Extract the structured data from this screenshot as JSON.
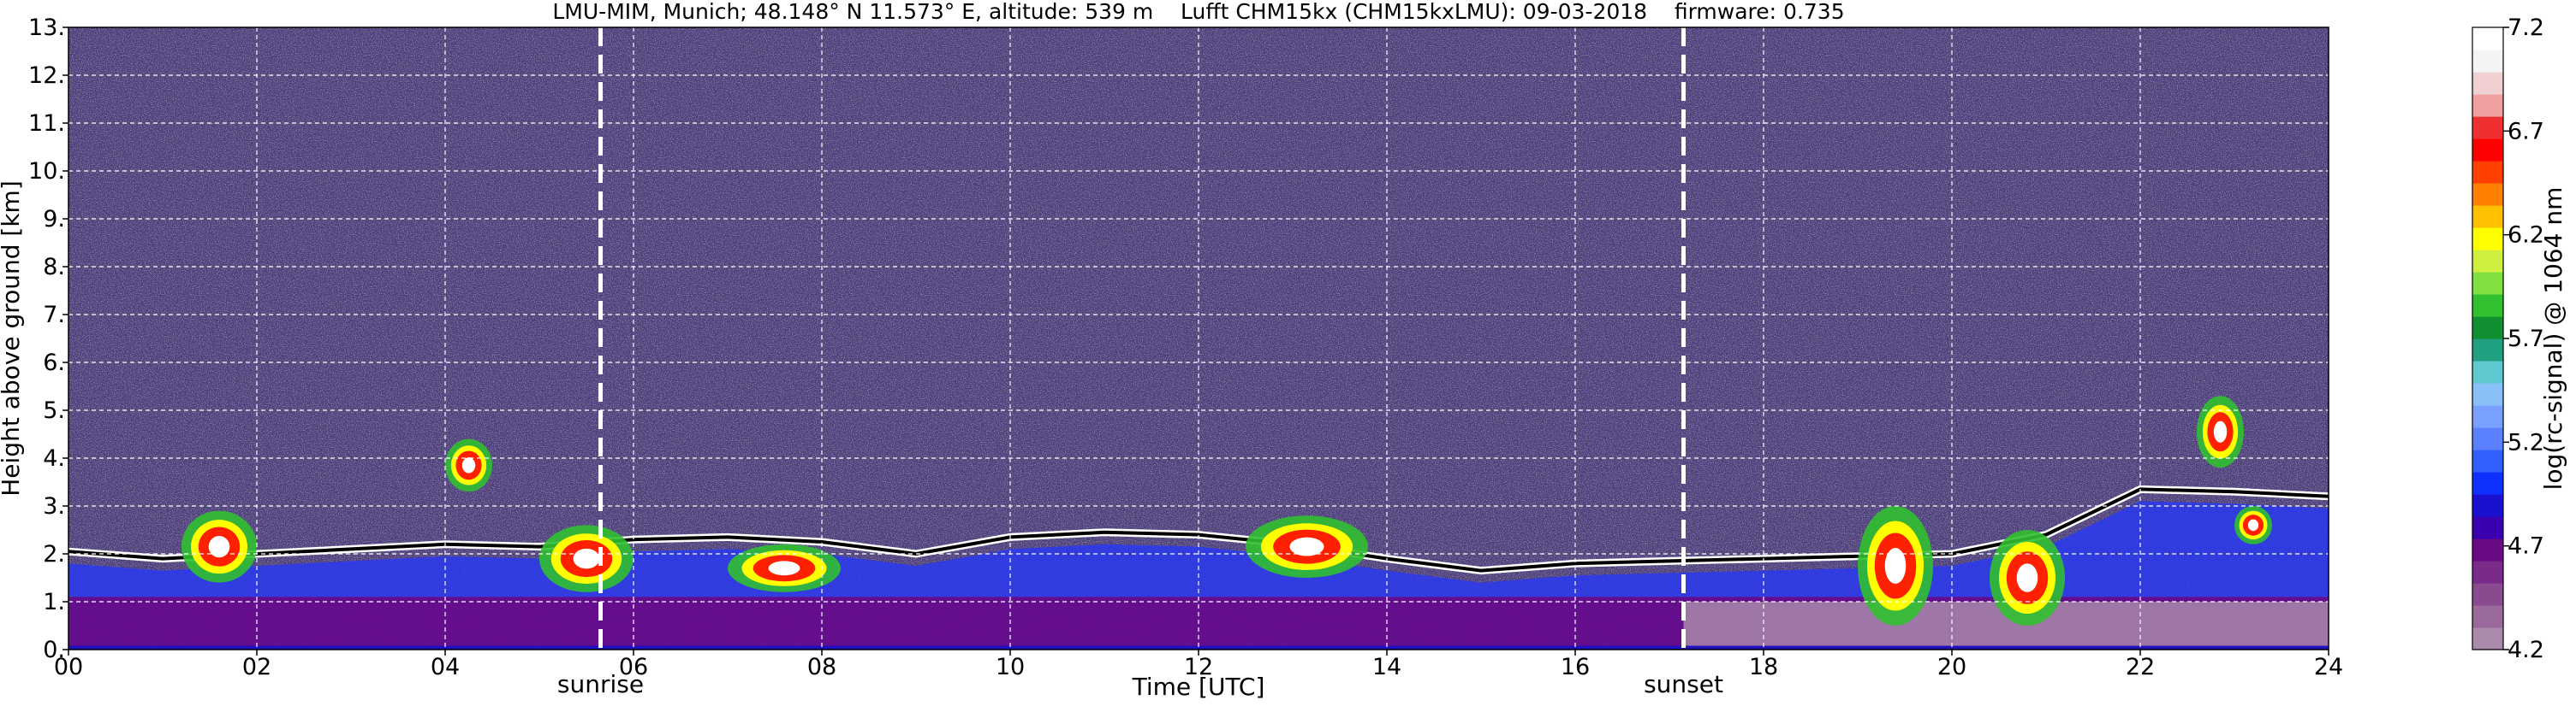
{
  "chart_data": {
    "type": "heatmap",
    "title": "LMU-MIM, Munich; 48.148° N 11.573° E, altitude: 539 m    Lufft CHM15kx (CHM15kxLMU): 09-03-2018    firmware: 0.735",
    "xlabel": "Time [UTC]",
    "ylabel": "Height above ground [km]",
    "xlim": [
      0,
      24
    ],
    "ylim": [
      0,
      13
    ],
    "x_ticks": [
      "00",
      "02",
      "04",
      "06",
      "08",
      "10",
      "12",
      "14",
      "16",
      "18",
      "20",
      "22",
      "24"
    ],
    "x_tick_values": [
      0,
      2,
      4,
      6,
      8,
      10,
      12,
      14,
      16,
      18,
      20,
      22,
      24
    ],
    "y_ticks": [
      "0.",
      "1.",
      "2.",
      "3.",
      "4.",
      "5.",
      "6.",
      "7.",
      "8.",
      "9.",
      "10.",
      "11.",
      "12.",
      "13."
    ],
    "y_tick_values": [
      0,
      1,
      2,
      3,
      4,
      5,
      6,
      7,
      8,
      9,
      10,
      11,
      12,
      13
    ],
    "grid": true,
    "events": [
      {
        "label": "sunrise",
        "time": 5.65
      },
      {
        "label": "sunset",
        "time": 17.15
      }
    ],
    "colorbar": {
      "label": "log(rc-signal) @ 1064 nm",
      "range": [
        4.2,
        7.2
      ],
      "ticks": [
        "4.2",
        "4.7",
        "5.2",
        "5.7",
        "6.2",
        "6.7",
        "7.2"
      ],
      "tick_values": [
        4.2,
        4.7,
        5.2,
        5.7,
        6.2,
        6.7,
        7.2
      ],
      "colors": [
        "#a98aab",
        "#9a6a9d",
        "#8a4a90",
        "#7a2a88",
        "#6a0a85",
        "#3a00b0",
        "#1a10d0",
        "#1030ff",
        "#3060ff",
        "#5a80ff",
        "#7aa0ff",
        "#8ac0f8",
        "#60c8d0",
        "#20a080",
        "#109030",
        "#30c030",
        "#80e040",
        "#d0f040",
        "#ffff00",
        "#ffc000",
        "#ff8000",
        "#ff4000",
        "#ff0000",
        "#ee3030",
        "#f0a0a0",
        "#f0d0d0",
        "#f4f4f4",
        "#ffffff"
      ]
    },
    "background_color": "#4a3d78",
    "boundary_layer_top_km": [
      [
        0,
        2.05
      ],
      [
        1,
        1.9
      ],
      [
        2,
        2.0
      ],
      [
        3,
        2.1
      ],
      [
        4,
        2.2
      ],
      [
        5,
        2.15
      ],
      [
        6,
        2.3
      ],
      [
        7,
        2.35
      ],
      [
        8,
        2.25
      ],
      [
        9,
        2.0
      ],
      [
        10,
        2.35
      ],
      [
        11,
        2.45
      ],
      [
        12,
        2.4
      ],
      [
        13,
        2.2
      ],
      [
        14,
        1.9
      ],
      [
        15,
        1.65
      ],
      [
        16,
        1.8
      ],
      [
        17,
        1.85
      ],
      [
        18,
        1.9
      ],
      [
        19,
        1.95
      ],
      [
        20,
        2.0
      ],
      [
        21,
        2.4
      ],
      [
        22,
        3.35
      ],
      [
        23,
        3.3
      ],
      [
        24,
        3.2
      ]
    ],
    "cloud_features": [
      {
        "t0": 4.0,
        "t1": 4.5,
        "h0": 3.3,
        "h1": 4.4
      },
      {
        "t0": 22.6,
        "t1": 23.1,
        "h0": 3.8,
        "h1": 5.3
      },
      {
        "t0": 23.0,
        "t1": 23.4,
        "h0": 2.2,
        "h1": 3.0
      },
      {
        "t0": 1.2,
        "t1": 2.0,
        "h0": 1.4,
        "h1": 2.9
      },
      {
        "t0": 5.0,
        "t1": 6.0,
        "h0": 1.2,
        "h1": 2.6
      },
      {
        "t0": 7.0,
        "t1": 8.2,
        "h0": 1.2,
        "h1": 2.2
      },
      {
        "t0": 12.5,
        "t1": 13.8,
        "h0": 1.5,
        "h1": 2.8
      },
      {
        "t0": 19.0,
        "t1": 19.8,
        "h0": 0.5,
        "h1": 3.0
      },
      {
        "t0": 20.4,
        "t1": 21.2,
        "h0": 0.5,
        "h1": 2.5
      }
    ]
  }
}
